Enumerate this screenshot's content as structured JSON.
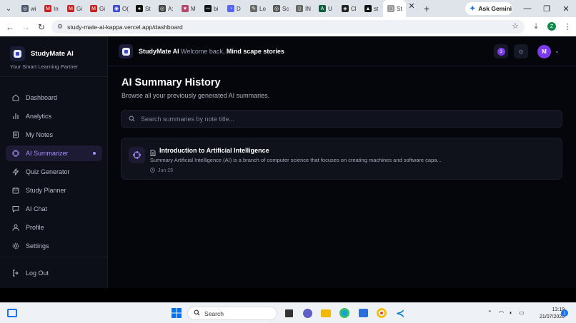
{
  "browser": {
    "tabs": [
      {
        "label": "wi",
        "fav_color": "#4a5568",
        "fav_glyph": "◎"
      },
      {
        "label": "In",
        "fav_color": "#c5221f",
        "fav_glyph": "M"
      },
      {
        "label": "Gi",
        "fav_color": "#c5221f",
        "fav_glyph": "M"
      },
      {
        "label": "Gi",
        "fav_color": "#c5221f",
        "fav_glyph": "M"
      },
      {
        "label": "O(",
        "fav_color": "#3a4bd1",
        "fav_glyph": "◉"
      },
      {
        "label": "St",
        "fav_color": "#111111",
        "fav_glyph": "●"
      },
      {
        "label": "A:",
        "fav_color": "#444444",
        "fav_glyph": "◎"
      },
      {
        "label": "M",
        "fav_color": "#b34a6c",
        "fav_glyph": "♥"
      },
      {
        "label": "bi",
        "fav_color": "#111111",
        "fav_glyph": "∾"
      },
      {
        "label": "D",
        "fav_color": "#5865f2",
        "fav_glyph": "◔"
      },
      {
        "label": "Lo",
        "fav_color": "#6b6b6b",
        "fav_glyph": "✎"
      },
      {
        "label": "Sc",
        "fav_color": "#555555",
        "fav_glyph": "◎"
      },
      {
        "label": "IN",
        "fav_color": "#666666",
        "fav_glyph": "▯"
      },
      {
        "label": "U",
        "fav_color": "#0b5e3b",
        "fav_glyph": "A"
      },
      {
        "label": "Cl",
        "fav_color": "#222222",
        "fav_glyph": "◈"
      },
      {
        "label": "st",
        "fav_color": "#111111",
        "fav_glyph": "▲"
      },
      {
        "label": "St",
        "fav_color": "#999999",
        "fav_glyph": "▢"
      }
    ],
    "gemini_label": "Ask Gemini",
    "url": "study-mate-ai-kappa.vercel.app/dashboard"
  },
  "sidebar": {
    "brand": "StudyMate AI",
    "tagline": "Your Smart Learning Partner",
    "items": [
      {
        "label": "Dashboard",
        "icon": "home-icon"
      },
      {
        "label": "Analytics",
        "icon": "bar-chart-icon"
      },
      {
        "label": "My Notes",
        "icon": "notes-icon"
      },
      {
        "label": "AI Summarizer",
        "icon": "cpu-icon",
        "active": true
      },
      {
        "label": "Quiz Generator",
        "icon": "lightning-icon"
      },
      {
        "label": "Study Planner",
        "icon": "calendar-icon"
      },
      {
        "label": "AI Chat",
        "icon": "chat-icon"
      },
      {
        "label": "Profile",
        "icon": "user-icon"
      },
      {
        "label": "Settings",
        "icon": "gear-icon"
      }
    ],
    "logout_label": "Log Out"
  },
  "topbar": {
    "title": "StudyMate AI",
    "welcome": "Welcome back,",
    "user_name": "Mind scape stories",
    "notification_count": "3",
    "avatar_initial": "M"
  },
  "main": {
    "title": "AI Summary History",
    "subtitle": "Browse all your previously generated AI summaries.",
    "search_placeholder": "Search summaries by note title...",
    "summaries": [
      {
        "title": "Introduction to Artificial Intelligence",
        "summary": "Summary Artificial Intelligence (AI) is a branch of computer science that focuses on creating machines and software capa...",
        "date": "Jun 29"
      }
    ]
  },
  "taskbar": {
    "search_label": "Search",
    "time": "13:19",
    "date": "21/07/2026",
    "notification_count": "1"
  },
  "colors": {
    "accent": "#7c3aed",
    "accent_light": "#a78bfa",
    "app_bg": "#05060b",
    "sidebar_bg": "#0c0e18"
  }
}
